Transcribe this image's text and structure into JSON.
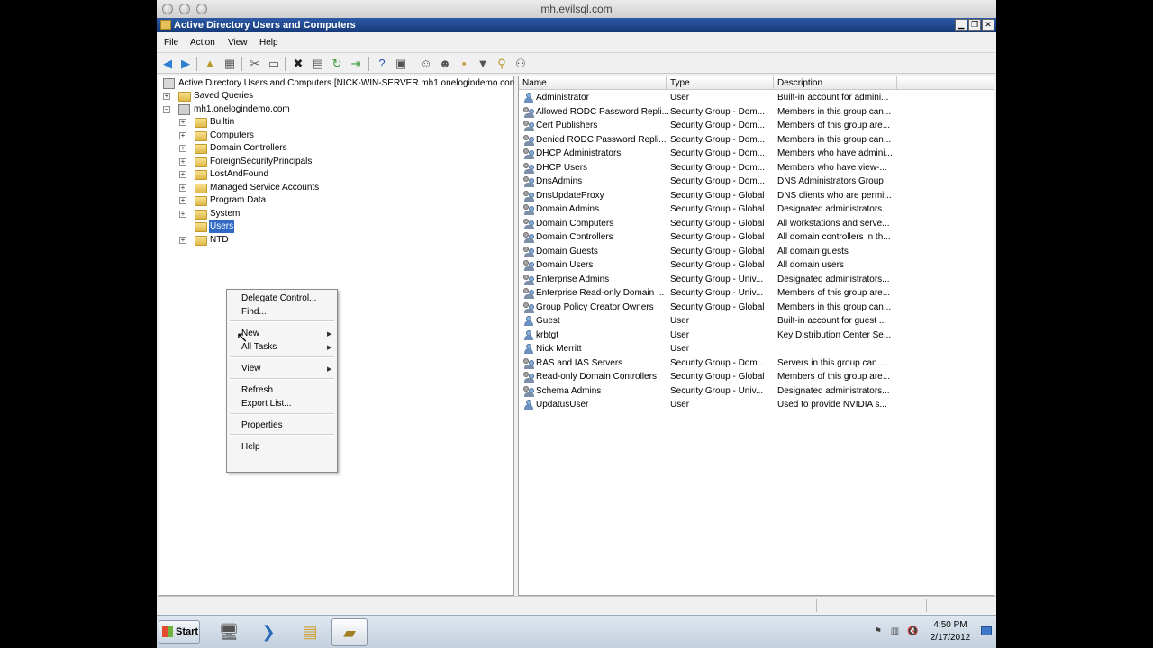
{
  "mac_window": {
    "title": "mh.evilsql.com"
  },
  "window": {
    "title": "Active Directory Users and Computers",
    "controls": {
      "minimize": "▁",
      "restore": "❐",
      "close": "✕"
    }
  },
  "menubar": [
    "File",
    "Action",
    "View",
    "Help"
  ],
  "tree": {
    "root": "Active Directory Users and Computers [NICK-WIN-SERVER.mh1.onelogindemo.com]",
    "saved_queries": "Saved Queries",
    "domain": "mh1.onelogindemo.com",
    "children": [
      "Builtin",
      "Computers",
      "Domain Controllers",
      "ForeignSecurityPrincipals",
      "LostAndFound",
      "Managed Service Accounts",
      "Program Data",
      "System",
      "Users",
      "NTDS Quotas"
    ],
    "selected": "Users",
    "ntds_visible": "NTD"
  },
  "context_menu": {
    "items": [
      "Delegate Control...",
      "Find...",
      "New",
      "All Tasks",
      "View",
      "Refresh",
      "Export List...",
      "Properties",
      "Help"
    ]
  },
  "list": {
    "columns": [
      "Name",
      "Type",
      "Description"
    ],
    "rows": [
      {
        "name": "Administrator",
        "type": "User",
        "desc": "Built-in account for admini...",
        "kind": "user"
      },
      {
        "name": "Allowed RODC Password Repli...",
        "type": "Security Group - Dom...",
        "desc": "Members in this group can...",
        "kind": "group"
      },
      {
        "name": "Cert Publishers",
        "type": "Security Group - Dom...",
        "desc": "Members of this group are...",
        "kind": "group"
      },
      {
        "name": "Denied RODC Password Repli...",
        "type": "Security Group - Dom...",
        "desc": "Members in this group can...",
        "kind": "group"
      },
      {
        "name": "DHCP Administrators",
        "type": "Security Group - Dom...",
        "desc": "Members who have admini...",
        "kind": "group"
      },
      {
        "name": "DHCP Users",
        "type": "Security Group - Dom...",
        "desc": "Members who have view-...",
        "kind": "group"
      },
      {
        "name": "DnsAdmins",
        "type": "Security Group - Dom...",
        "desc": "DNS Administrators Group",
        "kind": "group"
      },
      {
        "name": "DnsUpdateProxy",
        "type": "Security Group - Global",
        "desc": "DNS clients who are permi...",
        "kind": "group"
      },
      {
        "name": "Domain Admins",
        "type": "Security Group - Global",
        "desc": "Designated administrators...",
        "kind": "group"
      },
      {
        "name": "Domain Computers",
        "type": "Security Group - Global",
        "desc": "All workstations and serve...",
        "kind": "group"
      },
      {
        "name": "Domain Controllers",
        "type": "Security Group - Global",
        "desc": "All domain controllers in th...",
        "kind": "group"
      },
      {
        "name": "Domain Guests",
        "type": "Security Group - Global",
        "desc": "All domain guests",
        "kind": "group"
      },
      {
        "name": "Domain Users",
        "type": "Security Group - Global",
        "desc": "All domain users",
        "kind": "group"
      },
      {
        "name": "Enterprise Admins",
        "type": "Security Group - Univ...",
        "desc": "Designated administrators...",
        "kind": "group"
      },
      {
        "name": "Enterprise Read-only Domain ...",
        "type": "Security Group - Univ...",
        "desc": "Members of this group are...",
        "kind": "group"
      },
      {
        "name": "Group Policy Creator Owners",
        "type": "Security Group - Global",
        "desc": "Members in this group can...",
        "kind": "group"
      },
      {
        "name": "Guest",
        "type": "User",
        "desc": "Built-in account for guest ...",
        "kind": "user"
      },
      {
        "name": "krbtgt",
        "type": "User",
        "desc": "Key Distribution Center Se...",
        "kind": "user"
      },
      {
        "name": "Nick Merritt",
        "type": "User",
        "desc": "",
        "kind": "user"
      },
      {
        "name": "RAS and IAS Servers",
        "type": "Security Group - Dom...",
        "desc": "Servers in this group can ...",
        "kind": "group"
      },
      {
        "name": "Read-only Domain Controllers",
        "type": "Security Group - Global",
        "desc": "Members of this group are...",
        "kind": "group"
      },
      {
        "name": "Schema Admins",
        "type": "Security Group - Univ...",
        "desc": "Designated administrators...",
        "kind": "group"
      },
      {
        "name": "UpdatusUser",
        "type": "User",
        "desc": "Used to provide NVIDIA s...",
        "kind": "user"
      }
    ]
  },
  "taskbar": {
    "start_label": "Start",
    "clock_time": "4:50 PM",
    "clock_date": "2/17/2012"
  }
}
